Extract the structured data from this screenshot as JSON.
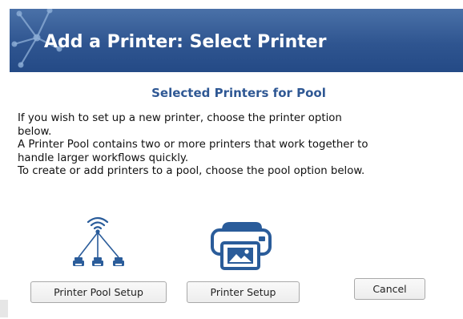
{
  "header": {
    "title": "Add a Printer: Select Printer",
    "background_color": "#2f5590",
    "decoration_icon": "network-nodes-icon"
  },
  "main": {
    "subtitle": "Selected Printers for Pool",
    "subtitle_color": "#2f5894",
    "description_lines": [
      "If you wish to set up a new printer, choose the printer option",
      "below.",
      "A Printer Pool contains two or more printers that work together to",
      "handle larger workflows quickly.",
      "To create or add printers to a pool, choose the pool option below."
    ]
  },
  "options": {
    "pool_icon": "printer-pool-icon",
    "printer_icon": "printer-icon",
    "icon_color": "#2a5c9a"
  },
  "buttons": {
    "pool_setup_label": "Printer Pool Setup",
    "printer_setup_label": "Printer Setup",
    "cancel_label": "Cancel"
  }
}
